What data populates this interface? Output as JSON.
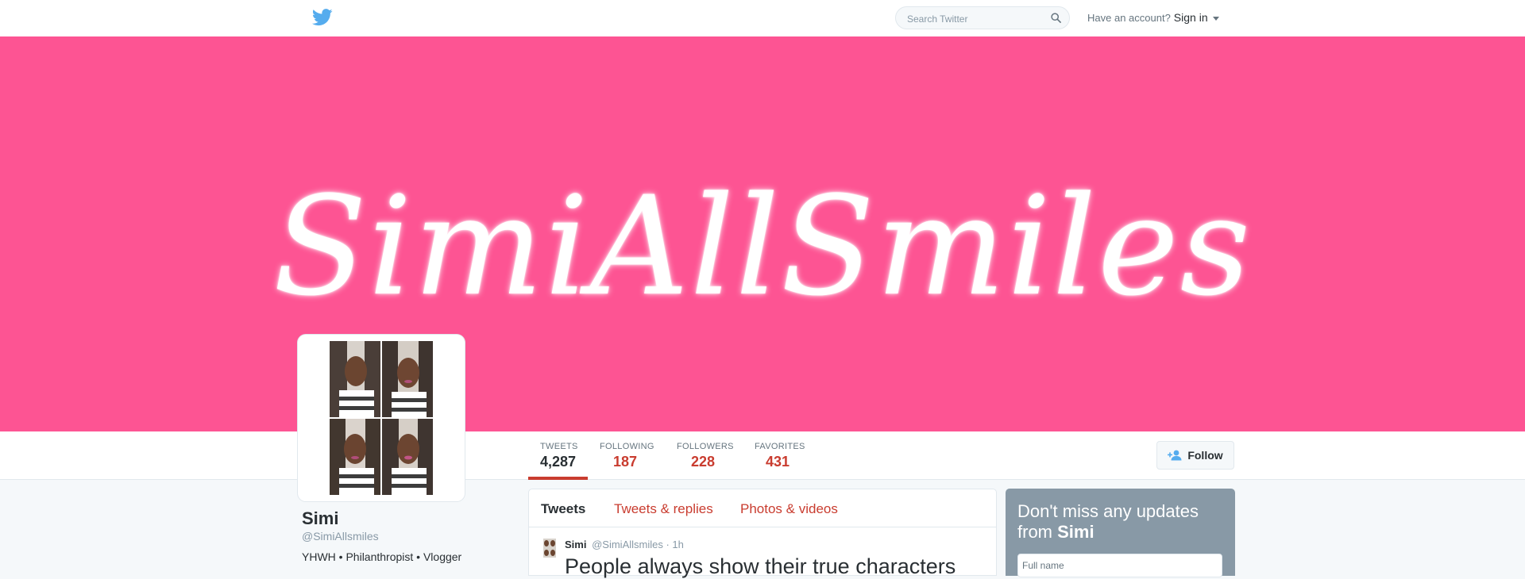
{
  "topbar": {
    "search_placeholder": "Search Twitter",
    "account_prompt": "Have an account?",
    "signin_label": "Sign in"
  },
  "banner": {
    "text": "SimiAllSmiles",
    "background_color": "#fd5493"
  },
  "stats": [
    {
      "label": "TWEETS",
      "value": "4,287"
    },
    {
      "label": "FOLLOWING",
      "value": "187"
    },
    {
      "label": "FOLLOWERS",
      "value": "228"
    },
    {
      "label": "FAVORITES",
      "value": "431"
    }
  ],
  "follow_label": "Follow",
  "profile": {
    "name": "Simi",
    "handle": "@SimiAllsmiles",
    "bio": "YHWH • Philanthropist • Vlogger"
  },
  "timeline": {
    "tabs": [
      "Tweets",
      "Tweets & replies",
      "Photos & videos"
    ],
    "tweet": {
      "author": "Simi",
      "handle": "@SimiAllsmiles",
      "time": "· 1h",
      "text": "People always show their true characters"
    }
  },
  "signup": {
    "heading_prefix": "Don't miss any updates from",
    "heading_name": "Simi",
    "fullname_placeholder": "Full name"
  },
  "colors": {
    "accent": "#c93c2f",
    "twitter_blue": "#55acee"
  },
  "icons": [
    "twitter-bird-icon",
    "search-icon",
    "add-user-icon"
  ]
}
